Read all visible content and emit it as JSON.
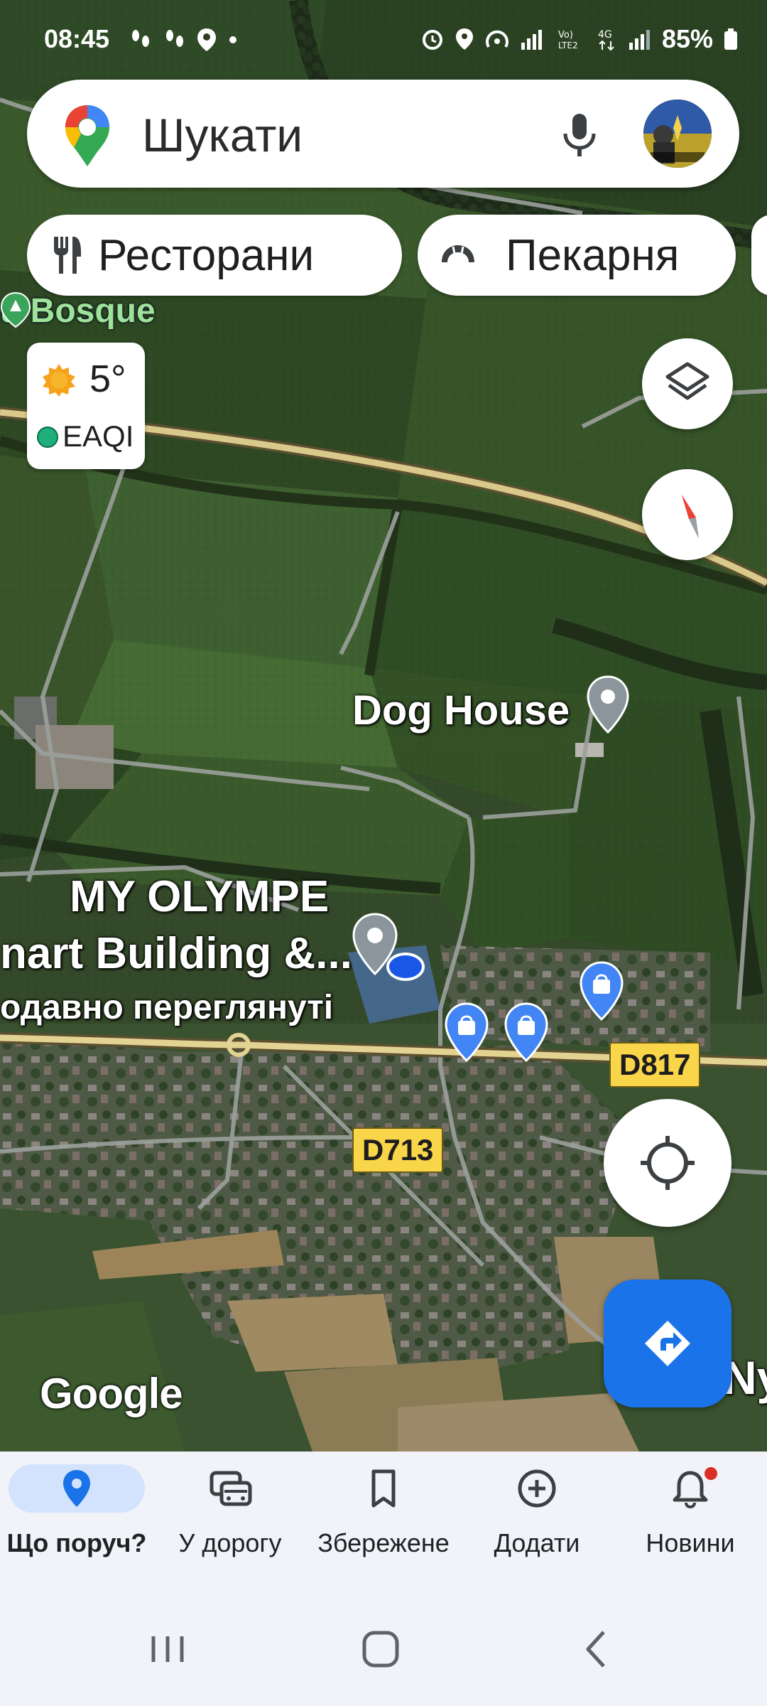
{
  "status_bar": {
    "time": "08:45",
    "battery": "85%"
  },
  "search": {
    "placeholder": "Шукати",
    "mic_icon": "mic-icon",
    "avatar_icon": "avatar"
  },
  "chips": [
    {
      "label": "Ресторани",
      "icon": "fork-knife-icon"
    },
    {
      "label": "Пекарня",
      "icon": "croissant-icon"
    }
  ],
  "weather": {
    "temp": "5°",
    "aqi_label": "EAQI",
    "aqi_color": "#1eaf7a"
  },
  "map": {
    "labels": {
      "bosque": "u Bosque",
      "dog_house": "Dog House",
      "olympe_line1": "MY OLYMPE",
      "olympe_line2": "nart Building &...",
      "olympe_line3": "одавно переглянуті",
      "corner": "Nyc"
    },
    "roads": {
      "d817": "D817",
      "d713": "D713"
    },
    "logo": "Google"
  },
  "bottom_nav": {
    "items": [
      {
        "label": "Що поруч?",
        "icon": "location-pin-icon",
        "active": true
      },
      {
        "label": "У дорогу",
        "icon": "commute-icon",
        "active": false
      },
      {
        "label": "Збережене",
        "icon": "bookmark-icon",
        "active": false
      },
      {
        "label": "Додати",
        "icon": "add-circle-icon",
        "active": false
      },
      {
        "label": "Новини",
        "icon": "bell-icon",
        "active": false
      }
    ]
  },
  "colors": {
    "accent": "#1a73e8",
    "active_nav_bg": "#d3e3fd",
    "road_shield": "#f9d54a",
    "notification": "#d93025"
  }
}
